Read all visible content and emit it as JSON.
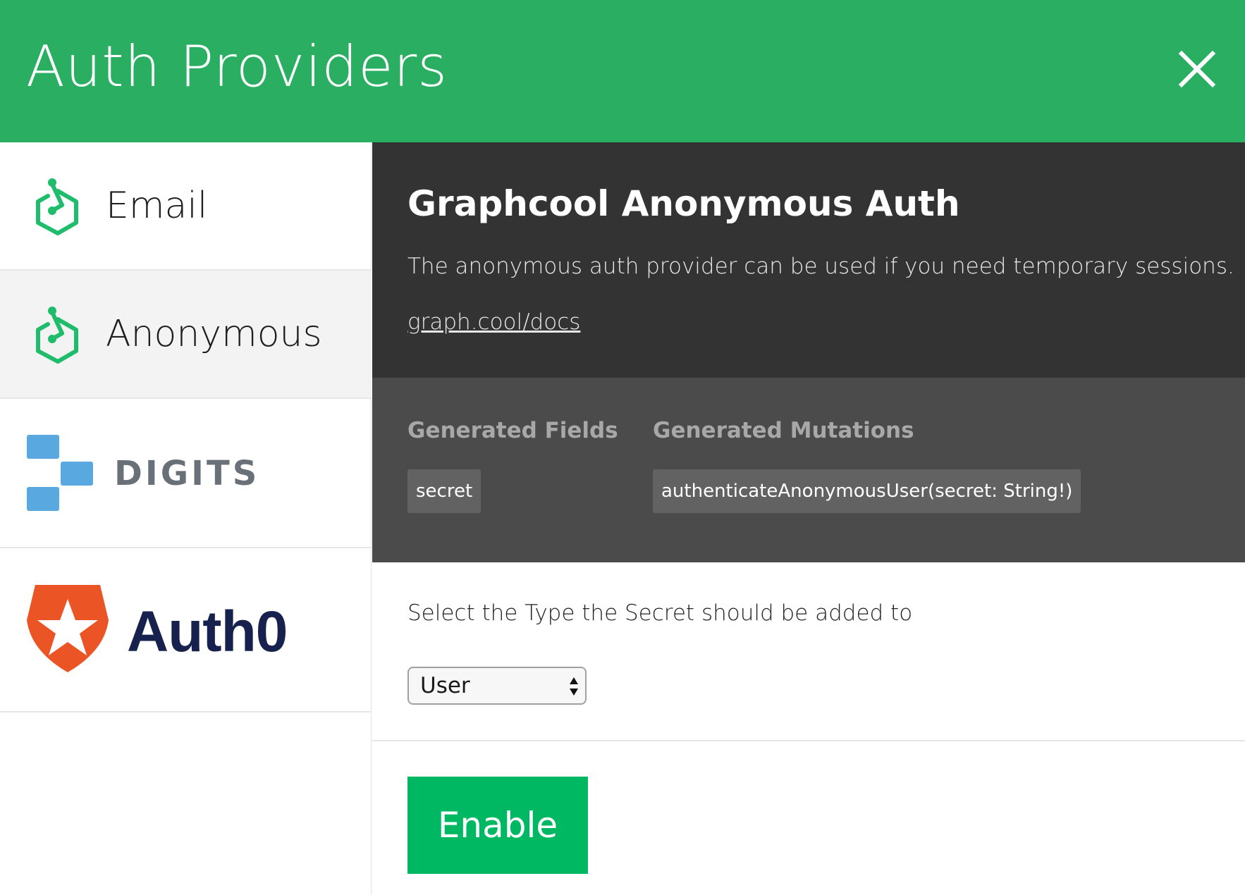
{
  "header": {
    "title": "Auth Providers",
    "close_icon": "close-icon"
  },
  "sidebar": {
    "items": [
      {
        "label": "Email",
        "icon": "graphcool-icon",
        "active": false
      },
      {
        "label": "Anonymous",
        "icon": "graphcool-icon",
        "active": true
      },
      {
        "label": "DIGITS",
        "icon": "digits-logo",
        "active": false
      },
      {
        "label": "Auth0",
        "icon": "auth0-logo",
        "active": false
      }
    ]
  },
  "main": {
    "title": "Graphcool Anonymous Auth",
    "description": "The anonymous auth provider can be used if you need temporary sessions.",
    "docs_link": "graph.cool/docs",
    "generated_fields_heading": "Generated Fields",
    "generated_mutations_heading": "Generated Mutations",
    "generated_fields": [
      "secret"
    ],
    "generated_mutations": [
      "authenticateAnonymousUser(secret: String!)"
    ],
    "select_label": "Select the Type the Secret should be added to",
    "select_value": "User",
    "enable_label": "Enable"
  },
  "colors": {
    "header_bg": "#2aae62",
    "brand_green": "#00b862",
    "panel_dark": "#333333",
    "panel_mid": "#4b4b4b",
    "digits_blue": "#5aa8e0",
    "auth0_orange": "#eb5424",
    "auth0_navy": "#16214d"
  }
}
